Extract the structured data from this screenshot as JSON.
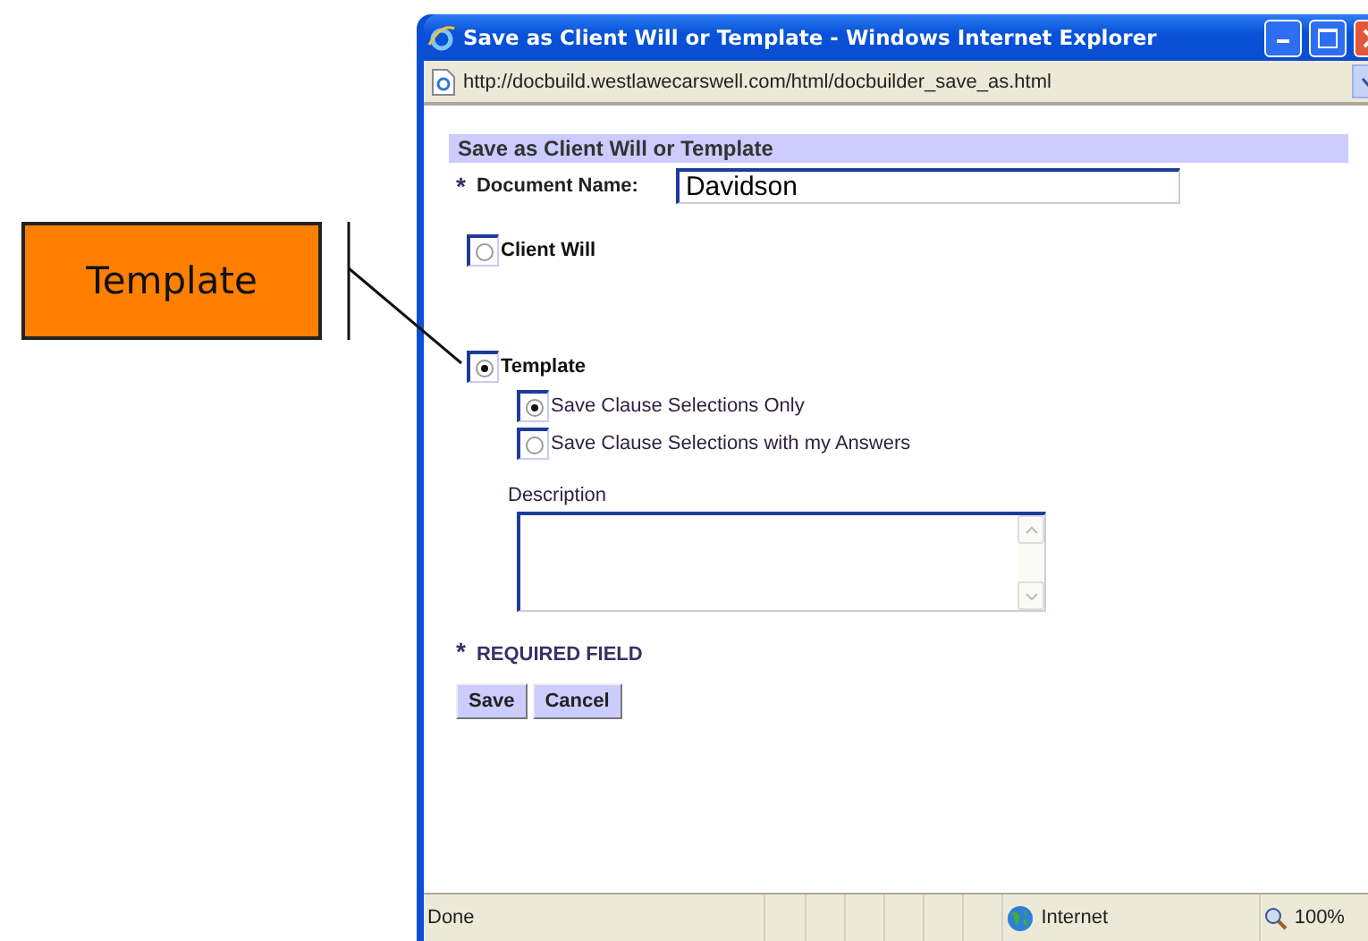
{
  "callout": {
    "label": "Template"
  },
  "window": {
    "title": "Save as Client Will or Template - Windows Internet Explorer",
    "url": "http://docbuild.westlawecarswell.com/html/docbuilder_save_as.html"
  },
  "form": {
    "heading": "Save as Client Will or Template",
    "required_mark": "*",
    "document_name_label": "Document Name:",
    "document_name": "Davidson",
    "save_types": [
      {
        "label": "Client Will",
        "selected": false
      },
      {
        "label": "Template",
        "selected": true,
        "options": [
          {
            "label": "Save Clause Selections Only",
            "selected": true
          },
          {
            "label": "Save Clause Selections with my Answers",
            "selected": false
          }
        ]
      }
    ],
    "description_label": "Description",
    "required_note": {
      "mark": "*",
      "label": "REQUIRED FIELD"
    },
    "buttons": [
      "Save",
      "Cancel"
    ]
  },
  "status_bar": {
    "text": "Done",
    "zone": "Internet",
    "zoom": "100%"
  }
}
